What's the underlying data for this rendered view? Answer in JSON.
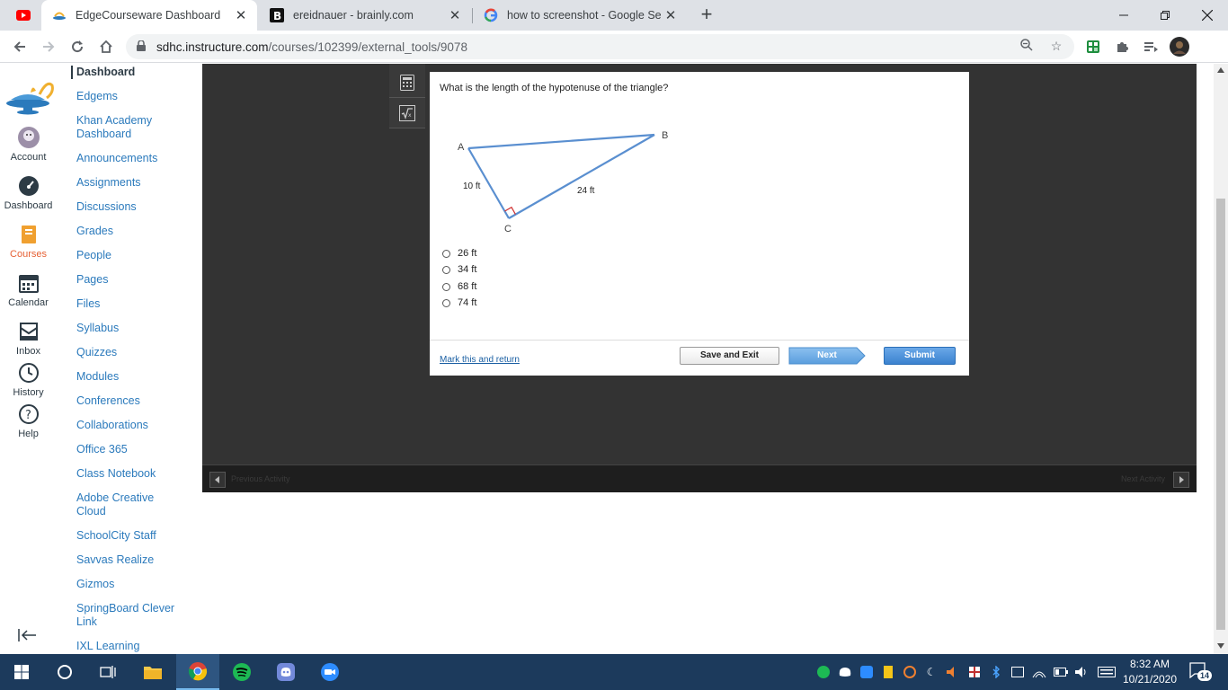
{
  "browser": {
    "tabs": [
      {
        "title": "EdgeCourseware Dashboard",
        "active": true
      },
      {
        "title": "ereidnauer - brainly.com",
        "active": false
      },
      {
        "title": "how to screenshot - Google Sear",
        "active": false
      }
    ],
    "url_host": "sdhc.instructure.com",
    "url_path": "/courses/102399/external_tools/9078"
  },
  "global_nav": {
    "items": [
      {
        "label": "Account"
      },
      {
        "label": "Dashboard"
      },
      {
        "label": "Courses"
      },
      {
        "label": "Calendar"
      },
      {
        "label": "Inbox"
      },
      {
        "label": "History"
      },
      {
        "label": "Help"
      }
    ]
  },
  "course_nav": {
    "current": "Dashboard",
    "items": [
      "Edgems",
      "Khan Academy Dashboard",
      "Announcements",
      "Assignments",
      "Discussions",
      "Grades",
      "People",
      "Pages",
      "Files",
      "Syllabus",
      "Quizzes",
      "Modules",
      "Conferences",
      "Collaborations",
      "Office 365",
      "Class Notebook",
      "Adobe Creative Cloud",
      "SchoolCity Staff",
      "Savvas Realize",
      "Gizmos",
      "SpringBoard Clever Link",
      "IXL Learning"
    ]
  },
  "question": {
    "prompt": "What is the length of the hypotenuse of the triangle?",
    "diagram": {
      "vertex_a": "A",
      "vertex_b": "B",
      "vertex_c": "C",
      "side_ac": "10 ft",
      "side_bc": "24 ft"
    },
    "options": [
      "26 ft",
      "34 ft",
      "68 ft",
      "74 ft"
    ],
    "mark_link": "Mark this and return",
    "save_button": "Save and Exit",
    "next_button": "Next",
    "submit_button": "Submit"
  },
  "player_bar": {
    "prev_label": "Previous Activity",
    "next_label": "Next Activity"
  },
  "taskbar": {
    "time": "8:32 AM",
    "date": "10/21/2020",
    "notifications": "14"
  },
  "colors": {
    "canvas_link": "#2b7abc",
    "courses_active": "#e66135",
    "triangle": "#5a8fd0",
    "right_angle": "#d03030",
    "submit": "#3b82cf"
  }
}
